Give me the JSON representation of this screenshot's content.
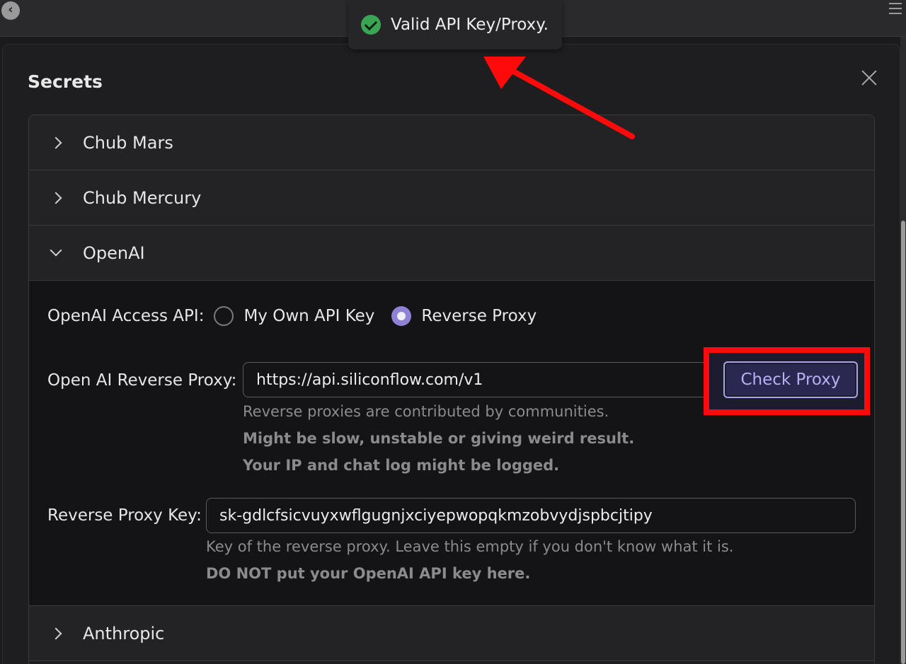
{
  "toast": {
    "message": "Valid API Key/Proxy."
  },
  "modal": {
    "title": "Secrets"
  },
  "sections": [
    {
      "label": "Chub Mars",
      "expanded": false
    },
    {
      "label": "Chub Mercury",
      "expanded": false
    },
    {
      "label": "OpenAI",
      "expanded": true
    },
    {
      "label": "Anthropic",
      "expanded": false
    }
  ],
  "openai": {
    "access_label": "OpenAI Access API:",
    "options": [
      "My Own API Key",
      "Reverse Proxy"
    ],
    "selected_option": "Reverse Proxy",
    "proxy_label": "Open AI Reverse Proxy:",
    "proxy_value": "https://api.siliconflow.com/v1",
    "check_button": "Check Proxy",
    "proxy_hint": "Reverse proxies are contributed by communities.",
    "proxy_warning_1": "Might be slow, unstable or giving weird result.",
    "proxy_warning_2": "Your IP and chat log might be logged.",
    "key_label": "Reverse Proxy Key:",
    "key_value": "sk-gdlcfsicvuyxwflgugnjxciyepwopqkmzobvydjspbcjtipy",
    "key_hint": "Key of the reverse proxy. Leave this empty if you don't know what it is.",
    "key_warning": "DO NOT put your OpenAI API key here."
  },
  "colors": {
    "accent": "#8d82d6",
    "annotation_red": "#ff0a0a",
    "success": "#3aa655"
  }
}
